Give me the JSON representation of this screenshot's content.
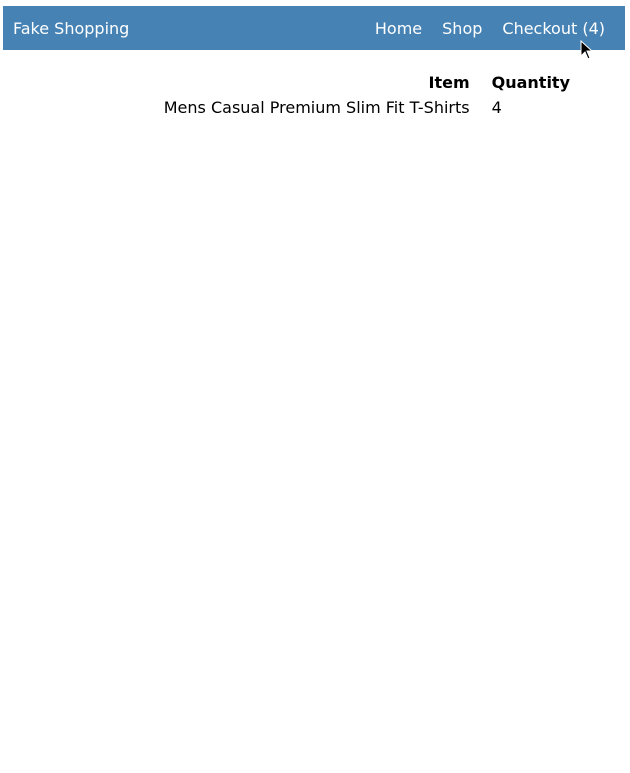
{
  "navbar": {
    "brand": "Fake Shopping",
    "links": {
      "home": "Home",
      "shop": "Shop",
      "checkout": "Checkout (4)"
    },
    "background_color": "#4682b4",
    "text_color": "#ffffff"
  },
  "cart": {
    "headers": {
      "item": "Item",
      "quantity": "Quantity"
    },
    "rows": [
      {
        "item": "Mens Casual Premium Slim Fit T-Shirts",
        "quantity": "4"
      }
    ]
  },
  "icons": {
    "cursor": "mouse-pointer-icon"
  }
}
